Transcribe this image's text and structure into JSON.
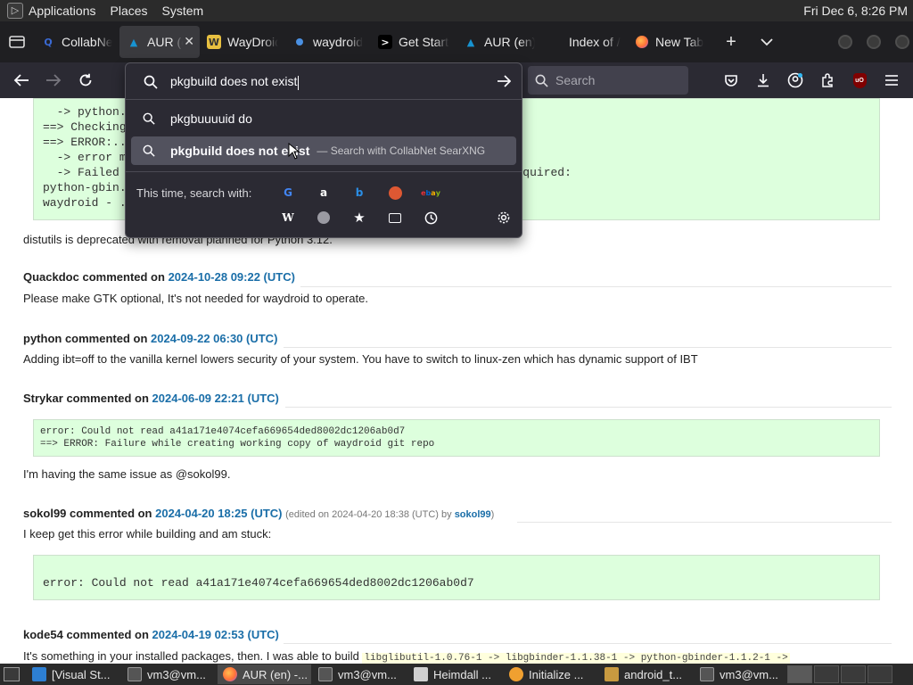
{
  "top_panel": {
    "menus": [
      "Applications",
      "Places",
      "System"
    ],
    "clock": "Fri Dec 6,  8:26 PM"
  },
  "tabs": [
    {
      "title": "CollabNet",
      "icon": "collabnet-icon",
      "color": "#3a6ad4"
    },
    {
      "title": "AUR (en)",
      "icon": "arch-icon",
      "color": "#1793d1",
      "active": true
    },
    {
      "title": "WayDroid",
      "icon": "waydroid-icon",
      "color": "#e8c040"
    },
    {
      "title": "waydroid",
      "icon": "waydroid-circle-icon",
      "color": "#4a90e2"
    },
    {
      "title": "Get Started",
      "icon": "terminal-icon",
      "color": "#111111"
    },
    {
      "title": "AUR (en)",
      "icon": "arch-icon",
      "color": "#1793d1"
    },
    {
      "title": "Index of /pf",
      "icon": "",
      "color": ""
    },
    {
      "title": "New Tab",
      "icon": "firefox-icon",
      "color": "#ff7139"
    }
  ],
  "navbar": {
    "search_placeholder": "Search"
  },
  "url_popup": {
    "query": "pkgbuild does not exist",
    "suggestion_1": "pkgbuuuuid do",
    "selected_bold": "pkgbuild do",
    "selected_bold_2": "es not exist",
    "selected_hint": "— Search with CollabNet SearXNG",
    "search_with_label": "This time, search with:",
    "engines": [
      {
        "name": "google-icon",
        "glyph": "G",
        "color": "#4285f4"
      },
      {
        "name": "amazon-icon",
        "glyph": "a",
        "color": "#ffffff"
      },
      {
        "name": "bing-icon",
        "glyph": "b",
        "color": "#2a8ee6"
      },
      {
        "name": "duckduckgo-icon",
        "glyph": "D",
        "color": "#de5833"
      },
      {
        "name": "ebay-icon",
        "glyph": "ebay",
        "color": "#e53238"
      },
      {
        "name": "wikipedia-icon",
        "glyph": "W",
        "color": "#ffffff"
      },
      {
        "name": "searxng-icon",
        "glyph": "Q",
        "color": "#9a9aa2"
      },
      {
        "name": "bookmarks-icon",
        "glyph": "★",
        "color": "#fbfbfe"
      },
      {
        "name": "tabs-icon",
        "glyph": "▭",
        "color": "#fbfbfe"
      },
      {
        "name": "history-icon",
        "glyph": "◷",
        "color": "#fbfbfe"
      },
      {
        "name": "settings-icon",
        "glyph": "⚙",
        "color": "#fbfbfe"
      }
    ]
  },
  "page": {
    "code_top_lines": [
      "  -> python...",
      "==> Checking...",
      "==> ERROR:...",
      "  -> error m...",
      "  -> Failed ...                                               n is required:",
      "python-gbin...",
      "waydroid - ..."
    ],
    "deprecation_note": "distutils is deprecated with removal planned for Python 3.12.",
    "comments": [
      {
        "author": "Quackdoc",
        "verb": "commented on",
        "date": "2024-10-28 09:22 (UTC)",
        "text": "Please make GTK optional, It's not needed for waydroid to operate."
      },
      {
        "author": "python",
        "verb": "commented on",
        "date": "2024-09-22 06:30 (UTC)",
        "text": "Adding ibt=off to the vanilla kernel lowers security of your system. You have to switch to linux-zen which has dynamic support of IBT"
      },
      {
        "author": "Strykar",
        "verb": "commented on",
        "date": "2024-06-09 22:21 (UTC)",
        "code": [
          "error: Could not read a41a171e4074cefa669654ded8002dc1206ab0d7",
          "==> ERROR: Failure while creating working copy of waydroid git repo"
        ],
        "text": "I'm having the same issue as @sokol99."
      },
      {
        "author": "sokol99",
        "verb": "commented on",
        "date": "2024-04-20 18:25 (UTC)",
        "edited": "(edited on 2024-04-20 18:38 (UTC) by",
        "edited_by": "sokol99",
        "edited_close": ")",
        "text": "I keep get this error while building and am stuck:",
        "code": [
          "error: Could not read a41a171e4074cefa669654ded8002dc1206ab0d7"
        ]
      },
      {
        "author": "kode54",
        "verb": "commented on",
        "date": "2024-04-19 02:53 (UTC)",
        "text": "It's something in your installed packages, then. I was able to build",
        "inline_code": "libglibutil-1.0.76-1 -> libgbinder-1.1.38-1 -> python-gbinder-1.1.2-1 ->"
      }
    ]
  },
  "taskbar": {
    "items": [
      {
        "label": "[Visual St...",
        "color": "#2d7fd3"
      },
      {
        "label": "vm3@vm...",
        "color": "#555555"
      },
      {
        "label": "AUR (en) -...",
        "color": "#ff7139",
        "active": true
      },
      {
        "label": "vm3@vm...",
        "color": "#555555"
      },
      {
        "label": "Heimdall ...",
        "color": "#d0d0d0"
      },
      {
        "label": "Initialize ...",
        "color": "#f0a030"
      },
      {
        "label": "android_t...",
        "color": "#c89a40"
      },
      {
        "label": "vm3@vm...",
        "color": "#555555"
      }
    ]
  }
}
